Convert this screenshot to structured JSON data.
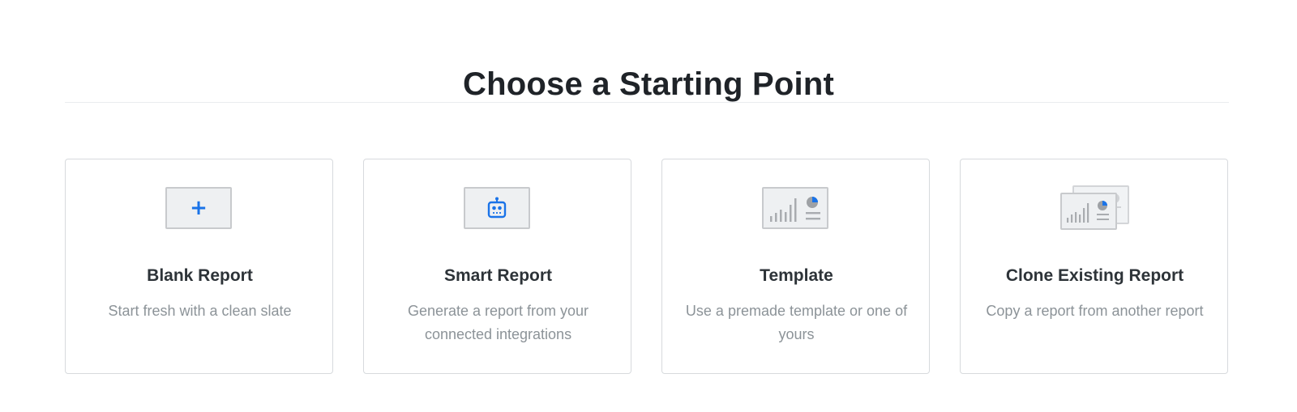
{
  "header": {
    "title": "Choose a Starting Point"
  },
  "colors": {
    "accent": "#1a73e8",
    "border": "#d7dadd",
    "title_text": "#1f2328",
    "desc_text": "#8c9398"
  },
  "cards": [
    {
      "title": "Blank Report",
      "description": "Start fresh with a clean slate",
      "icon": "plus-icon"
    },
    {
      "title": "Smart Report",
      "description": "Generate a report from your connected integrations",
      "icon": "robot-icon"
    },
    {
      "title": "Template",
      "description": "Use a premade template or one of yours",
      "icon": "template-chart-icon"
    },
    {
      "title": "Clone Existing Report",
      "description": "Copy a report from another report",
      "icon": "clone-report-icon"
    }
  ]
}
